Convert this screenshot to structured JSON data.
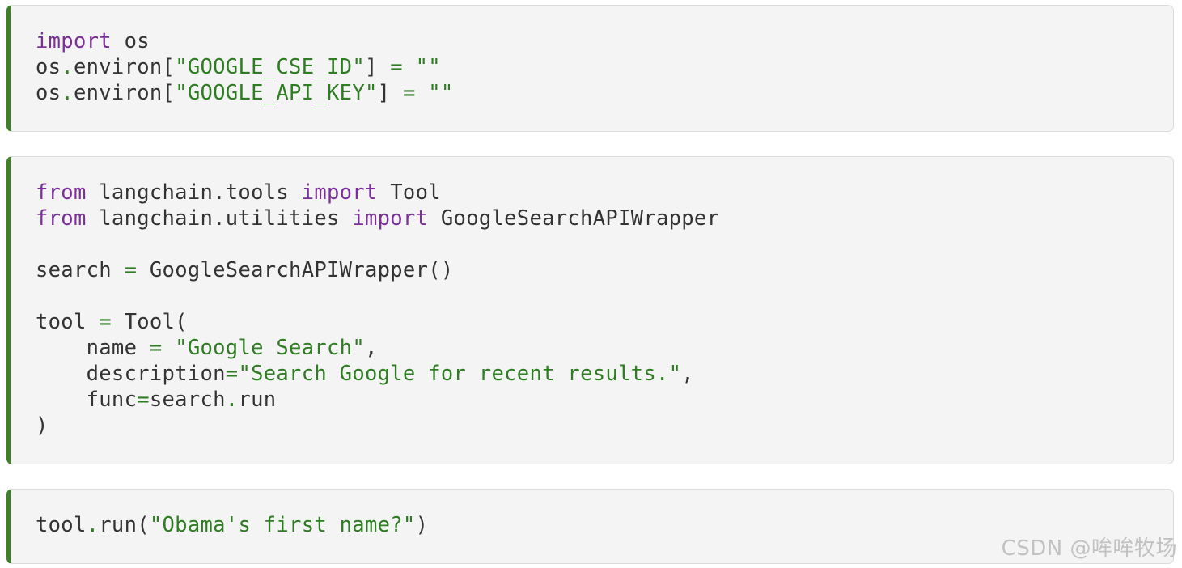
{
  "cells": [
    {
      "lines": [
        [
          {
            "t": "kw",
            "v": "import"
          },
          {
            "t": "txt",
            "v": " os"
          }
        ],
        [
          {
            "t": "txt",
            "v": "os"
          },
          {
            "t": "op",
            "v": "."
          },
          {
            "t": "txt",
            "v": "environ["
          },
          {
            "t": "str",
            "v": "\"GOOGLE_CSE_ID\""
          },
          {
            "t": "txt",
            "v": "] "
          },
          {
            "t": "op",
            "v": "="
          },
          {
            "t": "txt",
            "v": " "
          },
          {
            "t": "str",
            "v": "\"\""
          }
        ],
        [
          {
            "t": "txt",
            "v": "os"
          },
          {
            "t": "op",
            "v": "."
          },
          {
            "t": "txt",
            "v": "environ["
          },
          {
            "t": "str",
            "v": "\"GOOGLE_API_KEY\""
          },
          {
            "t": "txt",
            "v": "] "
          },
          {
            "t": "op",
            "v": "="
          },
          {
            "t": "txt",
            "v": " "
          },
          {
            "t": "str",
            "v": "\"\""
          }
        ]
      ]
    },
    {
      "lines": [
        [
          {
            "t": "kw",
            "v": "from"
          },
          {
            "t": "txt",
            "v": " langchain.tools "
          },
          {
            "t": "kw",
            "v": "import"
          },
          {
            "t": "txt",
            "v": " Tool"
          }
        ],
        [
          {
            "t": "kw",
            "v": "from"
          },
          {
            "t": "txt",
            "v": " langchain.utilities "
          },
          {
            "t": "kw",
            "v": "import"
          },
          {
            "t": "txt",
            "v": " GoogleSearchAPIWrapper"
          }
        ],
        [],
        [
          {
            "t": "txt",
            "v": "search "
          },
          {
            "t": "op",
            "v": "="
          },
          {
            "t": "txt",
            "v": " GoogleSearchAPIWrapper()"
          }
        ],
        [],
        [
          {
            "t": "txt",
            "v": "tool "
          },
          {
            "t": "op",
            "v": "="
          },
          {
            "t": "txt",
            "v": " Tool("
          }
        ],
        [
          {
            "t": "txt",
            "v": "    name "
          },
          {
            "t": "op",
            "v": "="
          },
          {
            "t": "txt",
            "v": " "
          },
          {
            "t": "str",
            "v": "\"Google Search\""
          },
          {
            "t": "txt",
            "v": ","
          }
        ],
        [
          {
            "t": "txt",
            "v": "    description"
          },
          {
            "t": "op",
            "v": "="
          },
          {
            "t": "str",
            "v": "\"Search Google for recent results.\""
          },
          {
            "t": "txt",
            "v": ","
          }
        ],
        [
          {
            "t": "txt",
            "v": "    func"
          },
          {
            "t": "op",
            "v": "="
          },
          {
            "t": "txt",
            "v": "search"
          },
          {
            "t": "op",
            "v": "."
          },
          {
            "t": "txt",
            "v": "run"
          }
        ],
        [
          {
            "t": "txt",
            "v": ")"
          }
        ]
      ]
    },
    {
      "lines": [
        [
          {
            "t": "txt",
            "v": "tool"
          },
          {
            "t": "op",
            "v": "."
          },
          {
            "t": "txt",
            "v": "run("
          },
          {
            "t": "str",
            "v": "\"Obama's first name?\""
          },
          {
            "t": "txt",
            "v": ")"
          }
        ]
      ]
    }
  ],
  "watermark": "CSDN @哞哞牧场",
  "colors": {
    "keyword": "#7b2f9a",
    "string": "#2e7d22",
    "text": "#333333",
    "cell_background": "#f4f4f4",
    "cell_accent": "#3f7f2a"
  }
}
